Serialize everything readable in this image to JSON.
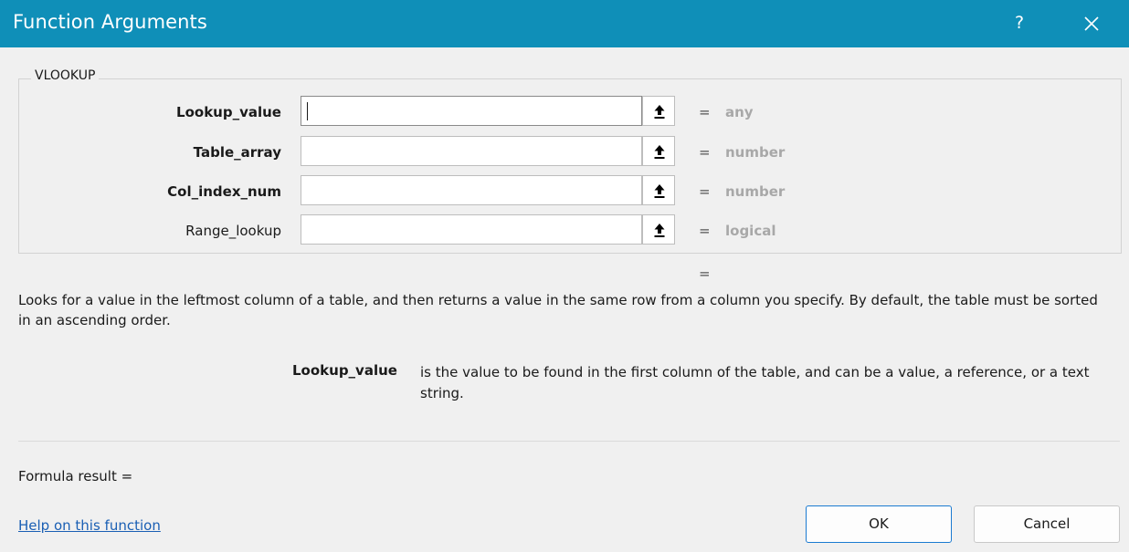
{
  "dialog": {
    "title": "Function Arguments",
    "help_glyph": "?",
    "close_icon": "close-icon",
    "title_bar_color": "#0f8fb8"
  },
  "function": {
    "name": "VLOOKUP",
    "arguments": [
      {
        "label": "Lookup_value",
        "required": true,
        "value": "",
        "equals": "=",
        "type": "any"
      },
      {
        "label": "Table_array",
        "required": true,
        "value": "",
        "equals": "=",
        "type": "number"
      },
      {
        "label": "Col_index_num",
        "required": true,
        "value": "",
        "equals": "=",
        "type": "number"
      },
      {
        "label": "Range_lookup",
        "required": false,
        "value": "",
        "equals": "=",
        "type": "logical"
      }
    ],
    "ref_button_icon": "collapse-dialog-icon",
    "result_equals": "="
  },
  "description": "Looks for a value in the leftmost column of a table, and then returns a value in the same row from a column you specify. By default, the table must be sorted in an ascending order.",
  "argument_help": {
    "name": "Lookup_value",
    "text": "is the value to be found in the first column of the table, and can be a value, a reference, or a text string."
  },
  "formula_result": "Formula result =",
  "help_link": "Help on this function",
  "buttons": {
    "ok": "OK",
    "cancel": "Cancel"
  }
}
